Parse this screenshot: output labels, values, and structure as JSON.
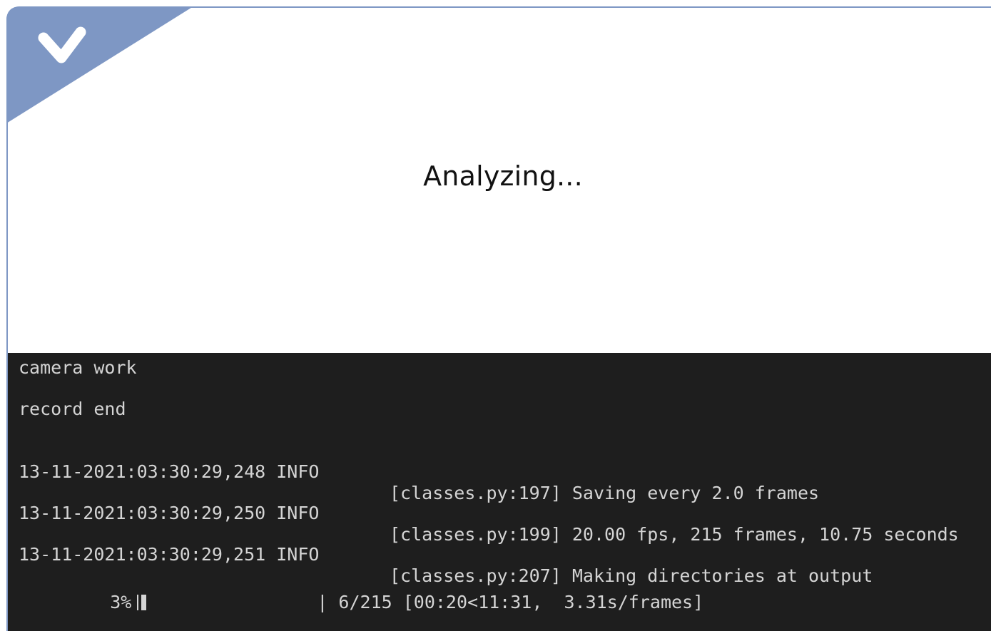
{
  "dialog": {
    "title": "Analyzing...",
    "check_icon": "checkmark-icon",
    "corner_color": "#7e97c4"
  },
  "terminal": {
    "background": "#1e1e1e",
    "lines": [
      "camera work",
      "record end"
    ],
    "log": [
      {
        "time": "13-11-2021:03:30:29,248 INFO",
        "message": "[classes.py:197] Saving every 2.0 frames"
      },
      {
        "time": "13-11-2021:03:30:29,250 INFO",
        "message": "[classes.py:199] 20.00 fps, 215 frames, 10.75 seconds"
      },
      {
        "time": "13-11-2021:03:30:29,251 INFO",
        "message": "[classes.py:207] Making directories at output"
      }
    ],
    "progress": {
      "percent_label": "3%",
      "fraction": 0.028,
      "status": "| 6/215 [00:20<11:31,  3.31s/frames]"
    }
  }
}
